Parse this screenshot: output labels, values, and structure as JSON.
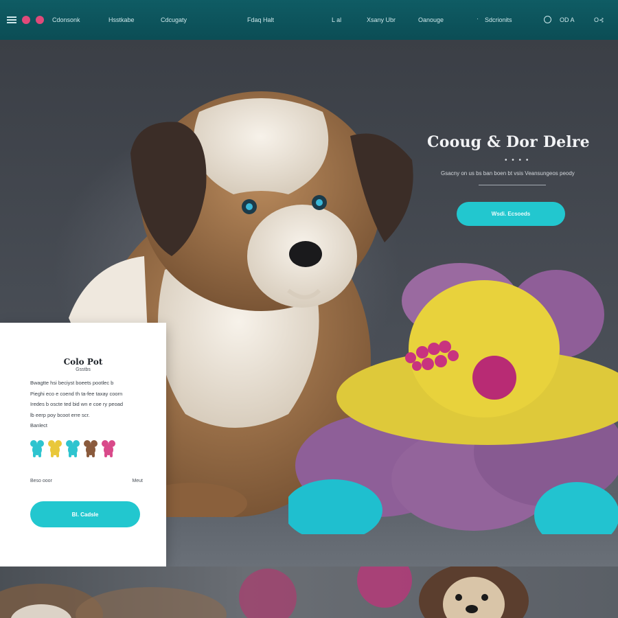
{
  "nav": {
    "left_items": [
      "Cdonsonk"
    ],
    "center_items": [
      "Hsstkabe",
      "Cdcugaty",
      "Fdaq Halt",
      "L al",
      "Xsany Ubr",
      "Oanouge",
      "Sdcrionits"
    ],
    "right_items": [
      "OD A"
    ],
    "right_arrow": "O⊰"
  },
  "hero": {
    "title": "Coоug & Dоr Delre",
    "dots": "• • • •",
    "subtitle": "Gsacny on us bs ban boen bt  vsis Veansungeos peody",
    "cta": "Wsdi. Ecsoeds"
  },
  "card": {
    "title": "Cоlo Pоt",
    "subtitle": "Gsstbs",
    "body": [
      "Bwagtte hsi beciyst boeets pootlec b",
      "Pieghi eco e coend th ta-fee taxay coorn",
      "Iredes b oscte ted bid wn e coe ry peoad",
      "lb eerp poy bcoot erre scr.",
      "Banlect"
    ],
    "row_left": "Beso ooor",
    "row_right": "Meut",
    "cta": "Bl. Cadsle",
    "swatch_colors": [
      "#2ec4cf",
      "#e9c73a",
      "#2ec4cf",
      "#8a5a3c",
      "#d94a8a"
    ]
  }
}
